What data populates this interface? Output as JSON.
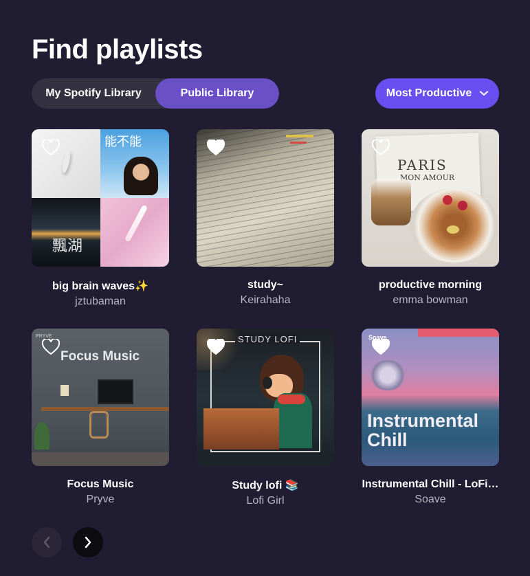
{
  "page": {
    "title": "Find playlists"
  },
  "tabs": [
    {
      "label": "My Spotify Library",
      "active": false
    },
    {
      "label": "Public Library",
      "active": true
    }
  ],
  "sort": {
    "label": "Most Productive",
    "icon": "chevron-down-icon"
  },
  "playlists": [
    {
      "name": "big brain waves✨",
      "author": "jztubaman",
      "liked": false,
      "cover_texts": [
        "能不能",
        "飄湖"
      ]
    },
    {
      "name": "study~",
      "author": "Keirahaha",
      "liked": true
    },
    {
      "name": "productive morning",
      "author": "emma bowman",
      "liked": false,
      "cover_texts": [
        "PARIS",
        "MON AMOUR"
      ]
    },
    {
      "name": "Focus Music",
      "author": "Pryve",
      "liked": false,
      "cover_texts": [
        "Focus Music",
        "PRYVE"
      ]
    },
    {
      "name": "Study lofi 📚",
      "author": "Lofi Girl",
      "liked": true,
      "cover_texts": [
        "STUDY LOFI"
      ]
    },
    {
      "name": "Instrumental Chill - LoFi…",
      "author": "Soave",
      "liked": true,
      "cover_texts": [
        "Instrumental Chill",
        "Soave"
      ]
    }
  ],
  "pagination": {
    "prev_icon": "chevron-left-icon",
    "next_icon": "chevron-right-icon",
    "prev_enabled": false,
    "next_enabled": true
  },
  "colors": {
    "background": "#201c31",
    "accent": "#6a4ff0",
    "tab_active": "#6b4fc6",
    "muted_text": "#b7b4c4"
  }
}
